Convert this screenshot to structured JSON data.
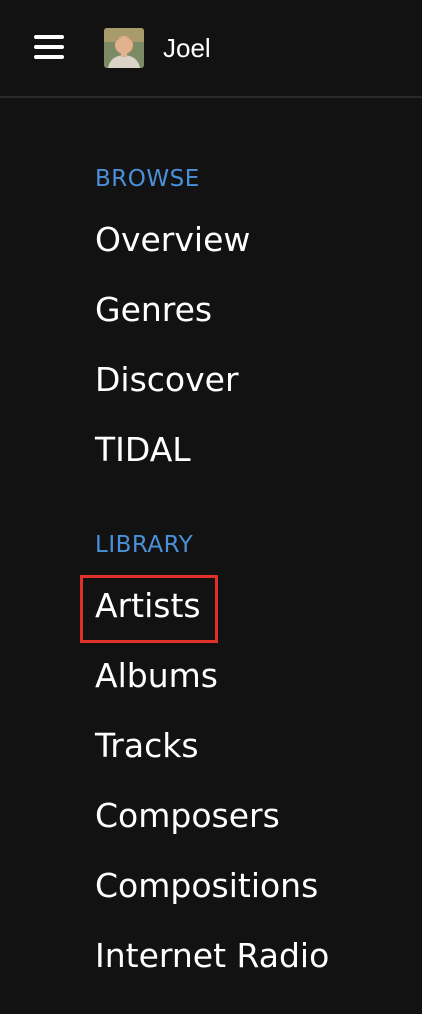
{
  "header": {
    "menu_icon": "hamburger-menu-icon",
    "avatar_icon": "user-avatar",
    "user_name": "Joel"
  },
  "sections": {
    "browse": {
      "title": "BROWSE",
      "items": [
        "Overview",
        "Genres",
        "Discover",
        "TIDAL"
      ]
    },
    "library": {
      "title": "LIBRARY",
      "items": [
        "Artists",
        "Albums",
        "Tracks",
        "Composers",
        "Compositions",
        "Internet Radio"
      ]
    }
  },
  "highlight": {
    "target": "Artists",
    "color": "#e0302a"
  },
  "colors": {
    "background": "#121212",
    "section_title": "#4a90d9",
    "text": "#ffffff"
  }
}
